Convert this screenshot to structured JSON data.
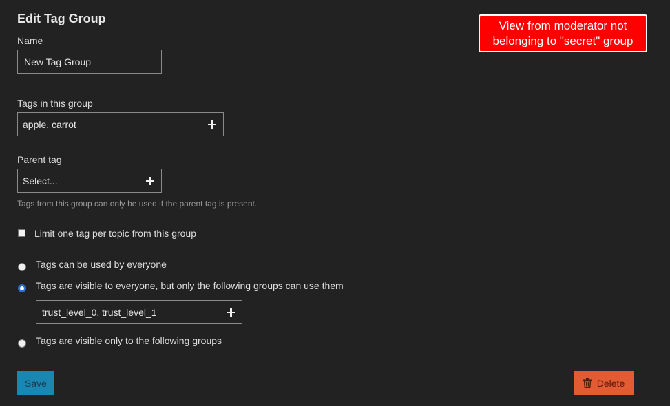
{
  "page": {
    "title": "Edit Tag Group"
  },
  "name_field": {
    "label": "Name",
    "value": "New Tag Group"
  },
  "tags_field": {
    "label": "Tags in this group",
    "value": "apple, carrot",
    "icon": "plus-icon"
  },
  "parent_tag": {
    "label": "Parent tag",
    "value": "Select...",
    "icon": "plus-icon",
    "hint": "Tags from this group can only be used if the parent tag is present."
  },
  "limit_one": {
    "label": "Limit one tag per topic from this group",
    "checked": false
  },
  "permissions": {
    "options": [
      {
        "label": "Tags can be used by everyone",
        "checked": false
      },
      {
        "label": "Tags are visible to everyone, but only the following groups can use them",
        "checked": true
      },
      {
        "label": "Tags are visible only to the following groups",
        "checked": false
      }
    ],
    "groups_value": "trust_level_0, trust_level_1"
  },
  "actions": {
    "save_label": "Save",
    "delete_label": "Delete",
    "delete_icon": "trash-icon"
  },
  "annotation": {
    "line1": "View from moderator not",
    "line2": "belonging to \"secret\" group"
  },
  "colors": {
    "background": "#222222",
    "save": "#1a87b3",
    "delete": "#e35b33",
    "callout": "#ff0000",
    "radio_selected": "#2a6fd6"
  }
}
